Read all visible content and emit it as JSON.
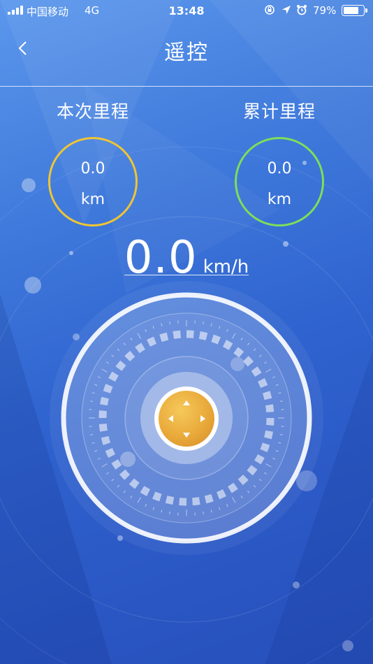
{
  "status_bar": {
    "carrier": "中国移动",
    "network": "4G",
    "time": "13:48",
    "battery_percent": "79%",
    "battery_level": 0.79,
    "icons": [
      "signal-icon",
      "rotation-lock-icon",
      "location-icon",
      "alarm-icon",
      "battery-icon"
    ]
  },
  "header": {
    "back_icon": "chevron-left-icon",
    "title": "遥控"
  },
  "stats": {
    "trip": {
      "label": "本次里程",
      "value": "0.0",
      "unit": "km",
      "color": "#f0c533"
    },
    "total": {
      "label": "累计里程",
      "value": "0.0",
      "unit": "km",
      "color": "#7dde5a"
    }
  },
  "speed": {
    "value": "0.0",
    "unit": "km/h"
  },
  "controller": {
    "joystick_icon": "direction-pad-icon",
    "knob_color": "#e9a93a",
    "directions": [
      "up",
      "down",
      "left",
      "right"
    ]
  },
  "colors": {
    "background": "#3f79db",
    "accent": "#ffffff"
  }
}
